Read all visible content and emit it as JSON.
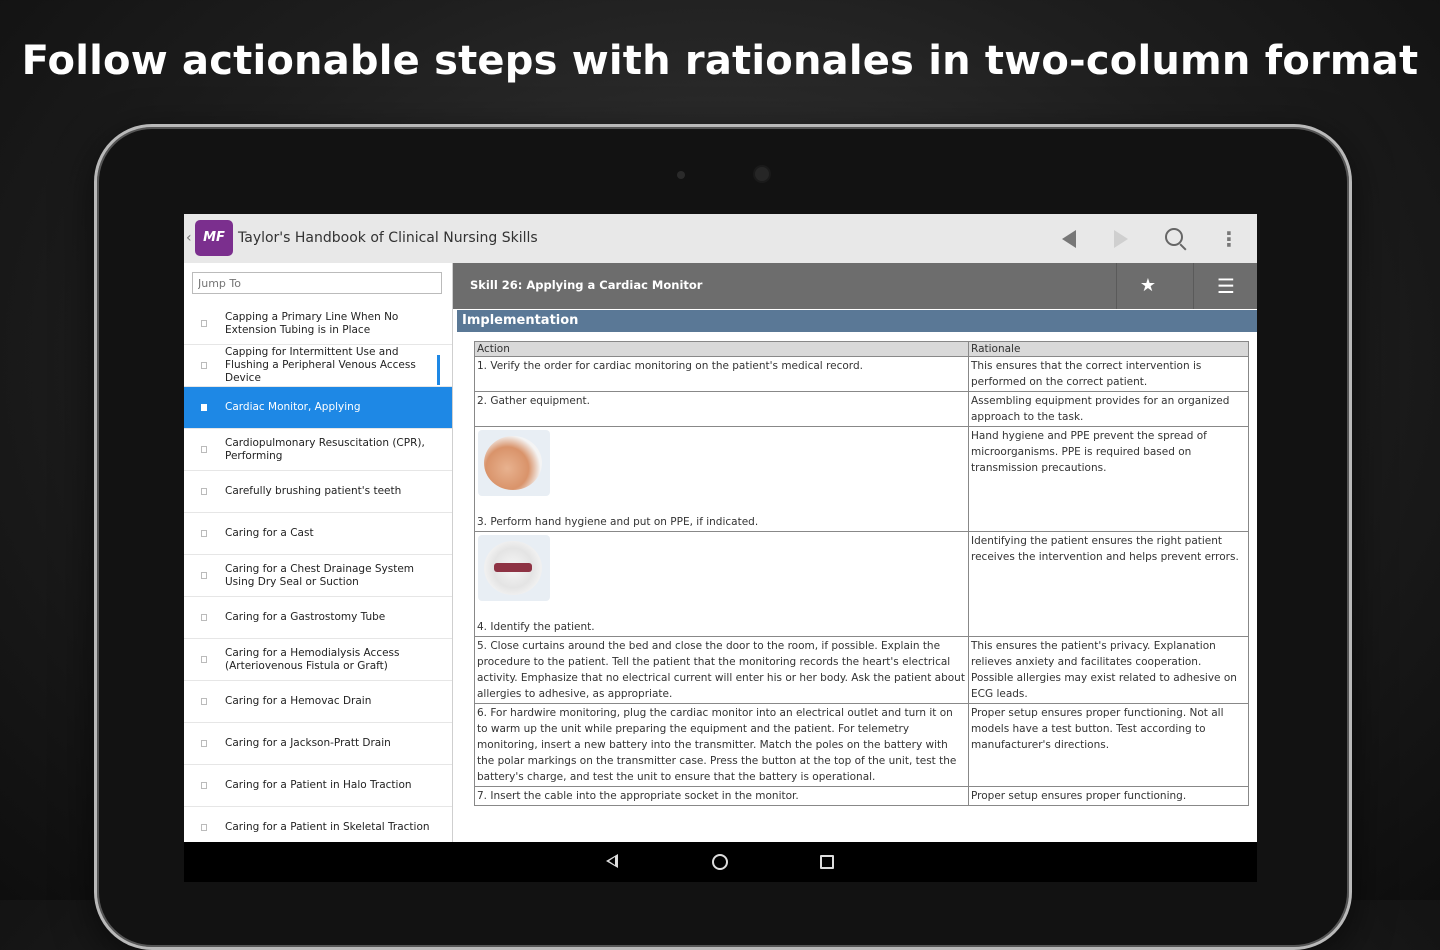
{
  "headline": "Follow actionable steps with rationales in two-column format",
  "app": {
    "icon_text": "MF",
    "title": "Taylor's Handbook of Clinical Nursing Skills",
    "accent": "#1e88e5",
    "icon_color": "#7b2f8e"
  },
  "sidebar": {
    "jump_placeholder": "Jump To",
    "items": [
      {
        "label": "Capping a Primary Line When No Extension Tubing is in Place"
      },
      {
        "label": "Capping for Intermittent Use and Flushing a Peripheral Venous Access Device"
      },
      {
        "label": "Cardiac Monitor, Applying",
        "active": true
      },
      {
        "label": "Cardiopulmonary Resuscitation (CPR), Performing"
      },
      {
        "label": "Carefully brushing patient's teeth"
      },
      {
        "label": "Caring for a Cast"
      },
      {
        "label": "Caring for a Chest Drainage System Using Dry Seal or Suction"
      },
      {
        "label": "Caring for a Gastrostomy Tube"
      },
      {
        "label": "Caring for a Hemodialysis Access (Arteriovenous Fistula or Graft)"
      },
      {
        "label": "Caring for a Hemovac Drain"
      },
      {
        "label": "Caring for a Jackson-Pratt Drain"
      },
      {
        "label": "Caring for a Patient in Halo Traction"
      },
      {
        "label": "Caring for a Patient in Skeletal Traction"
      }
    ]
  },
  "content": {
    "skill_title": "Skill 26: Applying a Cardiac Monitor",
    "section": "Implementation",
    "table": {
      "col_action": "Action",
      "col_rationale": "Rationale",
      "rows": [
        {
          "action": "1. Verify the order for cardiac monitoring on the patient's medical record.",
          "rationale": "This ensures that the correct intervention is performed on the correct patient."
        },
        {
          "action": "2. Gather equipment.",
          "rationale": "Assembling equipment provides for an organized approach to the task."
        },
        {
          "action": "3. Perform hand hygiene and put on PPE, if indicated.",
          "rationale": "Hand hygiene and PPE prevent the spread of microorganisms. PPE is required based on transmission precautions.",
          "image": "hands"
        },
        {
          "action": "4. Identify the patient.",
          "rationale": "Identifying the patient ensures the right patient receives the intervention and helps prevent errors.",
          "image": "band"
        },
        {
          "action": "5. Close curtains around the bed and close the door to the room, if possible. Explain the procedure to the patient. Tell the patient that the monitoring records the heart's electrical activity. Emphasize that no electrical current will enter his or her body. Ask the patient about allergies to adhesive, as appropriate.",
          "rationale": "This ensures the patient's privacy. Explanation relieves anxiety and facilitates cooperation. Possible allergies may exist related to adhesive on ECG leads."
        },
        {
          "action": "6. For hardwire monitoring, plug the cardiac monitor into an electrical outlet and turn it on to warm up the unit while preparing the equipment and the patient. For telemetry monitoring, insert a new battery into the transmitter. Match the poles on the battery with the polar markings on the transmitter case. Press the button at the top of the unit, test the battery's charge, and test the unit to ensure that the battery is operational.",
          "rationale": "Proper setup ensures proper functioning. Not all models have a test button. Test according to manufacturer's directions."
        },
        {
          "action": "7. Insert the cable into the appropriate socket in the monitor.",
          "rationale": "Proper setup ensures proper functioning."
        }
      ]
    }
  },
  "icons": {
    "back": "triangle-left-icon",
    "forward": "triangle-right-icon",
    "search": "search-icon",
    "overflow": "kebab-icon",
    "bookmark": "star-icon",
    "sort": "sort-icon"
  }
}
